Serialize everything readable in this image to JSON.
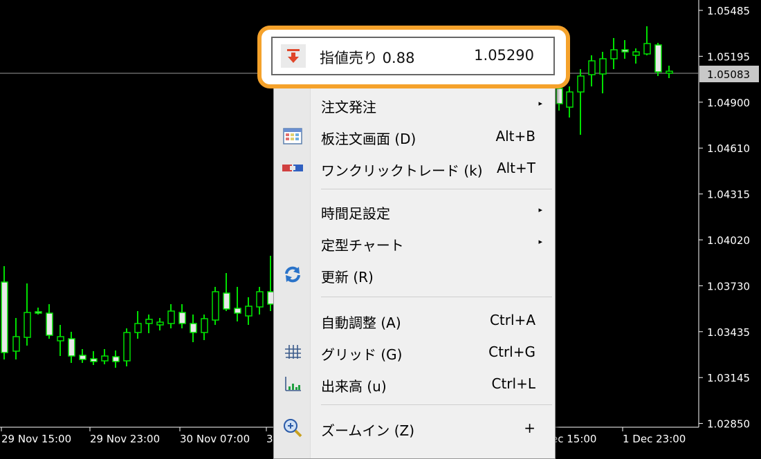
{
  "chart": {
    "price_axis": [
      "1.05485",
      "1.05195",
      "1.04900",
      "1.04610",
      "1.04315",
      "1.04020",
      "1.03730",
      "1.03435",
      "1.03145",
      "1.02850"
    ],
    "current_price": "1.05083",
    "time_axis": [
      "29 Nov 15:00",
      "29 Nov 23:00",
      "30 Nov 07:00",
      "3",
      "ec 15:00",
      "1 Dec 23:00"
    ],
    "colors": {
      "background": "#000000",
      "candle": "#00e000",
      "bid_line": "#9a9a9a",
      "price_tag": "#c8c8c8"
    }
  },
  "highlighted_item": {
    "icon": "sell-limit-arrow-icon",
    "label": "指値売り 0.88",
    "price": "1.05290"
  },
  "menu": {
    "items": [
      {
        "label": "注文発注",
        "shortcut": "",
        "submenu": true,
        "icon": ""
      },
      {
        "label": "板注文画面 (D)",
        "shortcut": "Alt+B",
        "submenu": false,
        "icon": "depth-of-market-icon"
      },
      {
        "label": "ワンクリックトレード (k)",
        "shortcut": "Alt+T",
        "submenu": false,
        "icon": "one-click-trading-icon"
      },
      {
        "label": "時間足設定",
        "shortcut": "",
        "submenu": true,
        "icon": ""
      },
      {
        "label": "定型チャート",
        "shortcut": "",
        "submenu": true,
        "icon": ""
      },
      {
        "label": "更新 (R)",
        "shortcut": "",
        "submenu": false,
        "icon": "refresh-icon"
      },
      {
        "label": "自動調整 (A)",
        "shortcut": "Ctrl+A",
        "submenu": false,
        "icon": ""
      },
      {
        "label": "グリッド (G)",
        "shortcut": "Ctrl+G",
        "submenu": false,
        "icon": "grid-icon"
      },
      {
        "label": "出来高 (u)",
        "shortcut": "Ctrl+L",
        "submenu": false,
        "icon": "volume-icon"
      },
      {
        "label": "ズームイン (Z)",
        "shortcut": "+",
        "submenu": false,
        "icon": "zoom-in-icon"
      }
    ]
  },
  "annotation": {
    "highlight_color": "#f5a22b"
  }
}
